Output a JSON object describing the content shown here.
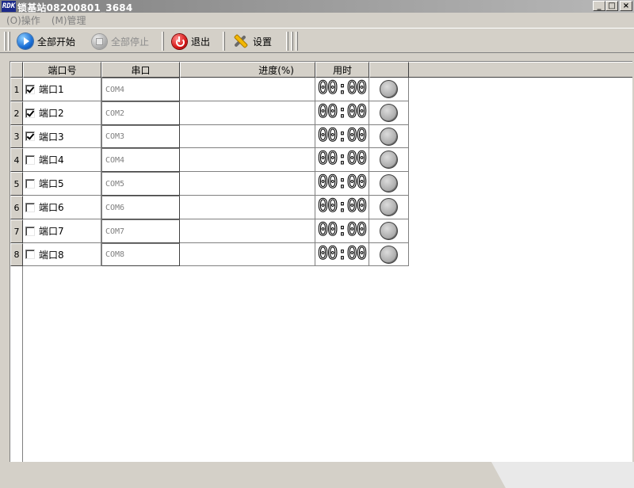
{
  "window": {
    "title": "锁基站08200801_3684",
    "app_logo_text": "RDK",
    "controls": [
      "_",
      "□",
      "×"
    ]
  },
  "menu": [
    {
      "label": "(O)操作"
    },
    {
      "label": "(M)管理"
    }
  ],
  "toolbar": {
    "start_all": "全部开始",
    "stop_all": "全部停止",
    "exit": "退出",
    "settings": "设置"
  },
  "table": {
    "headers": {
      "port": "端口号",
      "serial": "串口",
      "progress": "进度(%)",
      "time": "用时"
    },
    "rows": [
      {
        "num": "1",
        "checked": true,
        "port": "端口1",
        "serial": "COM4",
        "time": "00:00"
      },
      {
        "num": "2",
        "checked": true,
        "port": "端口2",
        "serial": "COM2",
        "time": "00:00"
      },
      {
        "num": "3",
        "checked": true,
        "port": "端口3",
        "serial": "COM3",
        "time": "00:00"
      },
      {
        "num": "4",
        "checked": false,
        "port": "端口4",
        "serial": "COM4",
        "time": "00:00"
      },
      {
        "num": "5",
        "checked": false,
        "port": "端口5",
        "serial": "COM5",
        "time": "00:00"
      },
      {
        "num": "6",
        "checked": false,
        "port": "端口6",
        "serial": "COM6",
        "time": "00:00"
      },
      {
        "num": "7",
        "checked": false,
        "port": "端口7",
        "serial": "COM7",
        "time": "00:00"
      },
      {
        "num": "8",
        "checked": false,
        "port": "端口8",
        "serial": "COM8",
        "time": "00:00"
      }
    ]
  },
  "colors": {
    "chrome": "#d4d0c8",
    "client_bg": "#ffffff",
    "start_icon": "#1a6fd6",
    "exit_icon": "#d81818",
    "status_led": "#b2b2b2"
  },
  "icons": {
    "start": "play-circle-icon",
    "stop": "stop-circle-icon",
    "exit": "power-icon",
    "settings": "wrench-pencil-icon",
    "status": "status-led-icon"
  }
}
